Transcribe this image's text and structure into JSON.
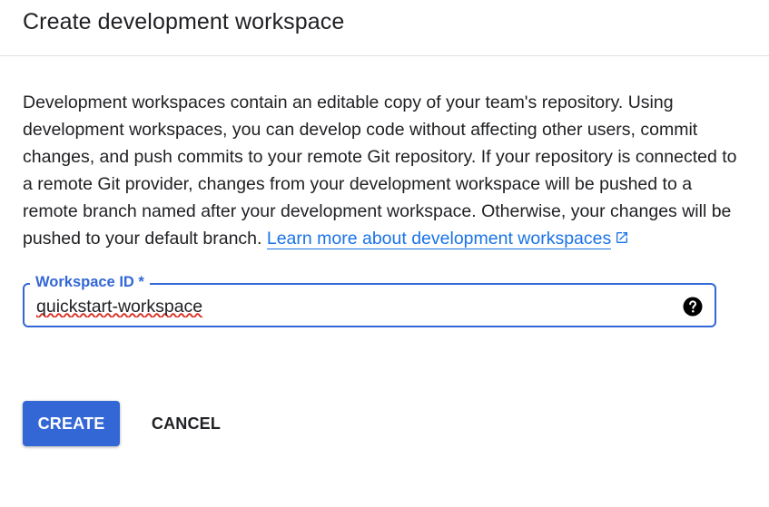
{
  "dialog": {
    "title": "Create development workspace",
    "description": "Development workspaces contain an editable copy of your team's repository. Using development workspaces, you can develop code without affecting other users, commit changes, and push commits to your remote Git repository. If your repository is connected to a remote Git provider, changes from your development workspace will be pushed to a remote branch named after your development workspace. Otherwise, your changes will be pushed to your default branch.",
    "learn_more_label": "Learn more about development workspaces",
    "external_link_icon": "open-in-new-icon"
  },
  "workspace_field": {
    "label": "Workspace ID *",
    "value": "quickstart-workspace",
    "help_icon": "help-circle-icon"
  },
  "actions": {
    "create_label": "CREATE",
    "cancel_label": "CANCEL"
  },
  "colors": {
    "accent": "#3367d6",
    "link": "#1a73e8",
    "text": "#202124",
    "divider": "#e0e0e0"
  }
}
